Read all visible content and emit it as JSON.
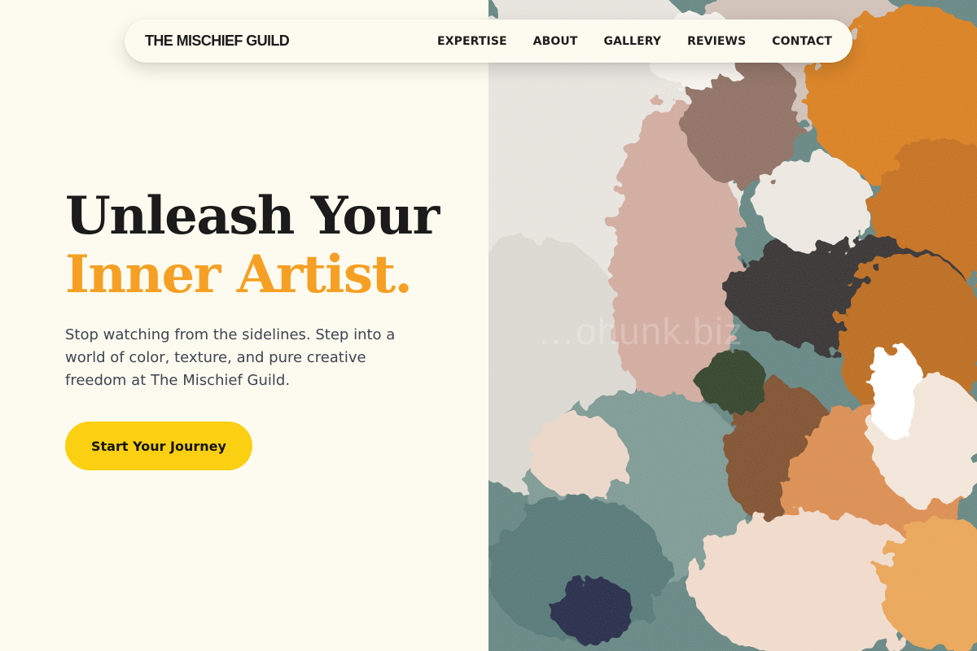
{
  "brand": {
    "name": "THE MISCHIEF GUILD"
  },
  "nav": {
    "links": [
      "EXPERTISE",
      "ABOUT",
      "GALLERY",
      "REVIEWS",
      "CONTACT"
    ]
  },
  "hero": {
    "headline_line1": "Unleash Your",
    "headline_line2": "Inner Artist.",
    "subtext": "Stop watching from the sidelines. Step into a world of color, texture, and pure creative freedom at The Mischief Guild.",
    "cta_label": "Start Your Journey"
  },
  "image": {
    "description": "impasto oil paint texture",
    "watermark": "…ohunk.biz"
  },
  "colors": {
    "background": "#fdfbef",
    "accent_orange": "#f5a024",
    "cta_yellow": "#fcd012",
    "text_dark": "#1b1b1b",
    "text_muted": "#3d4551"
  }
}
